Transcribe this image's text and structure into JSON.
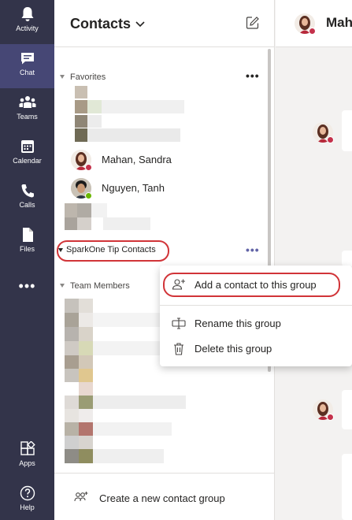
{
  "rail": {
    "items": [
      {
        "label": "Activity",
        "icon": "bell-icon"
      },
      {
        "label": "Chat",
        "icon": "chat-icon"
      },
      {
        "label": "Teams",
        "icon": "teams-icon"
      },
      {
        "label": "Calendar",
        "icon": "calendar-icon"
      },
      {
        "label": "Calls",
        "icon": "phone-icon"
      },
      {
        "label": "Files",
        "icon": "file-icon"
      }
    ],
    "more": "•••",
    "bottom": [
      {
        "label": "Apps",
        "icon": "apps-icon"
      },
      {
        "label": "Help",
        "icon": "help-icon"
      }
    ],
    "active_item": "Chat"
  },
  "contacts": {
    "title": "Contacts",
    "favorites": {
      "label": "Favorites",
      "people": [
        {
          "name": "Mahan, Sandra",
          "presence": "busy"
        },
        {
          "name": "Nguyen, Tanh",
          "presence": "available"
        }
      ]
    },
    "custom_group": {
      "label": "SparkOne Tip Contacts"
    },
    "team_members": {
      "label": "Team Members"
    },
    "create_group_label": "Create a new contact group",
    "more_dots": "•••"
  },
  "context_menu": {
    "items": [
      {
        "label": "Add a contact to this group",
        "icon": "add-person-icon"
      },
      {
        "label": "Rename this group",
        "icon": "rename-icon"
      },
      {
        "label": "Delete this group",
        "icon": "trash-icon"
      }
    ]
  },
  "chat_header": {
    "name": "Mah"
  },
  "colors": {
    "rail_bg": "#33344a",
    "rail_active": "#464775",
    "accent": "#6264a7",
    "highlight_ring": "#d13438",
    "presence_busy": "#c4314b",
    "presence_available": "#6bb700"
  }
}
